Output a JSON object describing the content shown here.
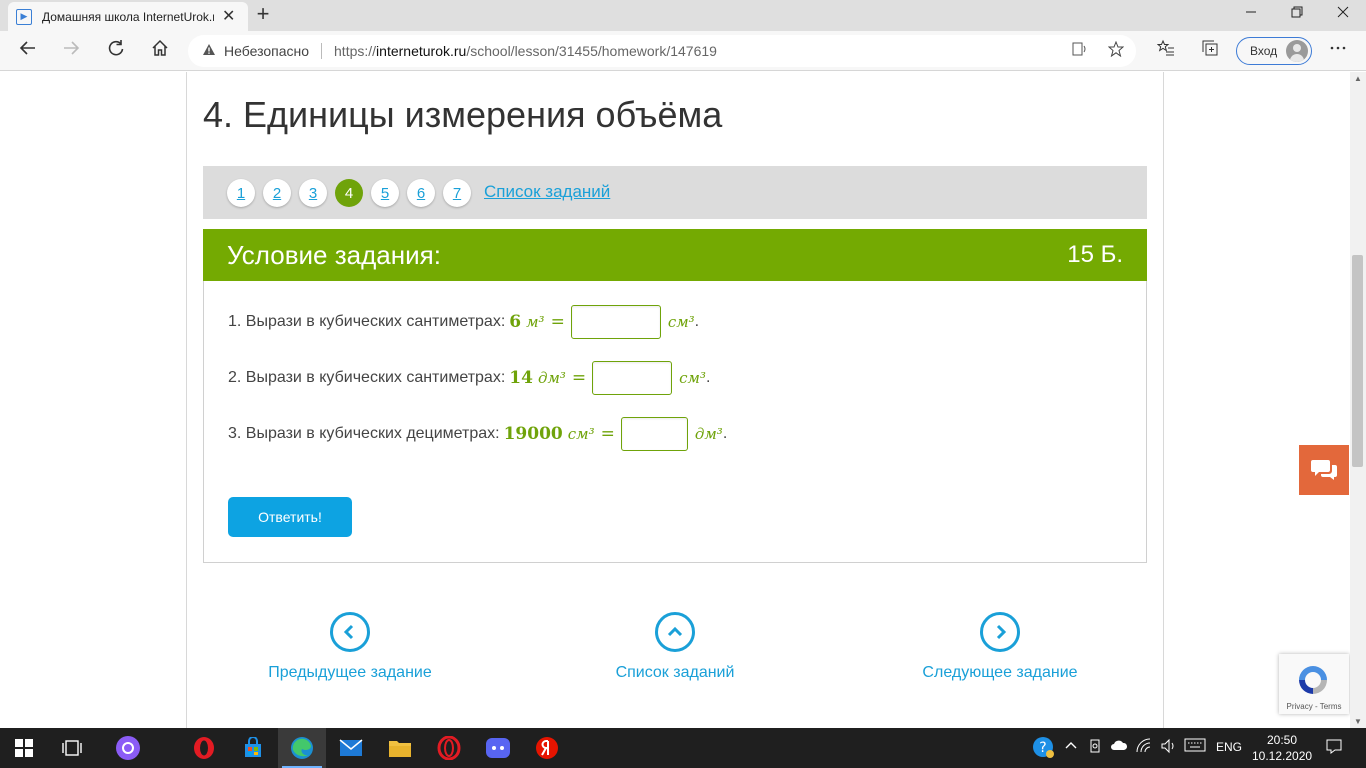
{
  "browser": {
    "tab_title": "Домашняя школа InternetUrok.ru",
    "tab_close": "✕",
    "new_tab": "+",
    "security_label": "Небезопасно",
    "url_prefix": "https://",
    "url_host": "interneturok.ru",
    "url_path": "/school/lesson/31455/homework/147619",
    "signin_label": "Вход"
  },
  "page": {
    "title": "4. Единицы измерения объёма",
    "task_numbers": [
      "1",
      "2",
      "3",
      "4",
      "5",
      "6",
      "7"
    ],
    "active_task": "4",
    "task_list_link": "Список заданий",
    "condition_title": "Условие задания:",
    "points": "15 Б.",
    "questions": [
      {
        "text": "1. Вырази в кубических сантиметрах:",
        "value": "6",
        "unit": "м³",
        "eq": "=",
        "answer": "",
        "answer_unit": "см³",
        "end": "."
      },
      {
        "text": "2. Вырази в кубических сантиметрах:",
        "value": "14",
        "unit": "дм³",
        "eq": "=",
        "answer": "",
        "answer_unit": "см³",
        "end": "."
      },
      {
        "text": "3. Вырази в кубических дециметрах:",
        "value": "19000",
        "unit": "см³",
        "eq": "=",
        "answer": "",
        "answer_unit": "дм³",
        "end": "."
      }
    ],
    "answer_button": "Ответить!",
    "nav": {
      "prev": "Предыдущее задание",
      "list": "Список заданий",
      "next": "Следующее задание"
    },
    "recaptcha_text": "Privacy - Terms"
  },
  "taskbar": {
    "lang": "ENG",
    "time": "20:50",
    "date": "10.12.2020"
  },
  "colors": {
    "accent_green": "#74aa02",
    "link_blue": "#1aa0d8",
    "button_blue": "#0da3e2",
    "chat_orange": "#e3683b"
  }
}
